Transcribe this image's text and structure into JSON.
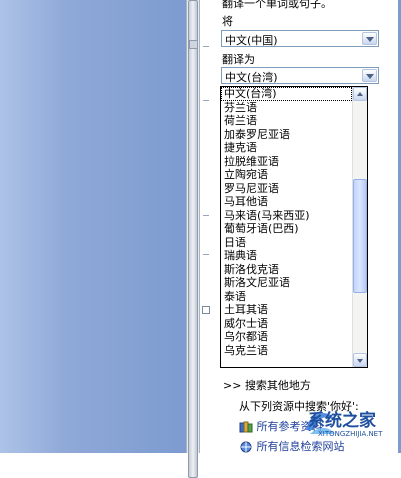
{
  "pane": {
    "intro_text": "翻译一个单词或句子。",
    "from_label": "将",
    "from_value": "中文(中国)",
    "to_label": "翻译为",
    "to_value": "中文(台湾)",
    "language_options": [
      "中文(台湾)",
      "芬兰语",
      "荷兰语",
      "加泰罗尼亚语",
      "捷克语",
      "拉脱维亚语",
      "立陶宛语",
      "罗马尼亚语",
      "马耳他语",
      "马来语(马来西亚)",
      "葡萄牙语(巴西)",
      "日语",
      "瑞典语",
      "斯洛伐克语",
      "斯洛文尼亚语",
      "泰语",
      "土耳其语",
      "威尔士语",
      "乌尔都语",
      "乌克兰语"
    ],
    "search_other_label": "搜索其他地方",
    "search_other_prefix": ">>",
    "search_source_text": "从下列资源中搜索'你好':",
    "partial_link_1": "所有参考资料",
    "partial_link_2": "所有信息检索网站"
  },
  "watermark": {
    "text": "系统之家",
    "url_text": "XITONGZHIJIA.NET"
  },
  "colors": {
    "doc_background": "#8fa9d8",
    "combo_border": "#7f9db9",
    "accent_blue": "#2a5db0"
  }
}
